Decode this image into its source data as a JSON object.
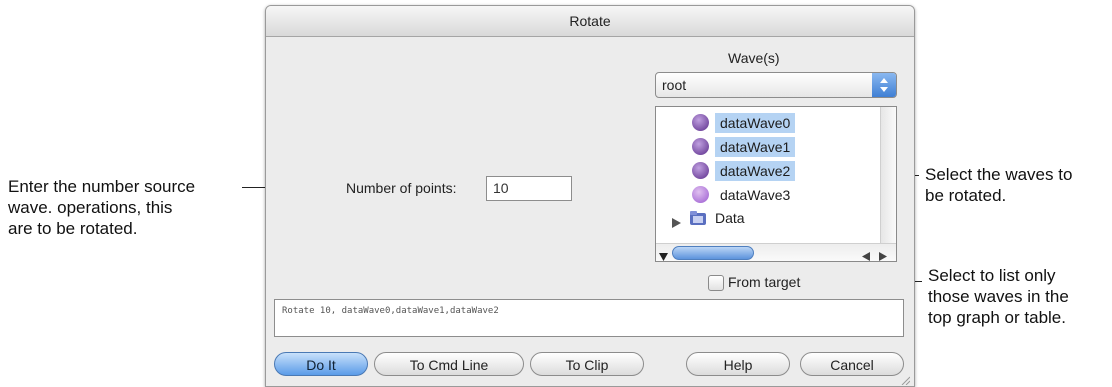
{
  "dialog": {
    "title": "Rotate",
    "number_of_points_label": "Number of points:",
    "number_of_points_value": "10",
    "waves_label": "Wave(s)",
    "folder_popup_value": "root",
    "wave_list": [
      {
        "label": "dataWave0",
        "selected": true,
        "icon": "wave-icon"
      },
      {
        "label": "dataWave1",
        "selected": true,
        "icon": "wave-icon"
      },
      {
        "label": "dataWave2",
        "selected": true,
        "icon": "wave-icon"
      },
      {
        "label": "dataWave3",
        "selected": false,
        "icon": "wave-icon"
      },
      {
        "label": "Data",
        "selected": false,
        "icon": "folder-icon"
      }
    ],
    "from_target_label": "From target",
    "command_text": "Rotate 10, dataWave0,dataWave1,dataWave2",
    "buttons": {
      "do_it": "Do It",
      "to_cmd_line": "To Cmd Line",
      "to_clip": "To Clip",
      "help": "Help",
      "cancel": "Cancel"
    }
  },
  "callouts": {
    "number_points": [
      "Enter the number source",
      "wave. operations, this",
      "are to be rotated."
    ],
    "select_waves": [
      "Select the waves to",
      "be rotated."
    ],
    "from_target": [
      "Select to list only",
      "those waves in the",
      "top graph or table."
    ]
  },
  "colors": {
    "accent": "#5b9be8",
    "selection": "#b5d3f3",
    "dialog_bg": "#ececec"
  }
}
